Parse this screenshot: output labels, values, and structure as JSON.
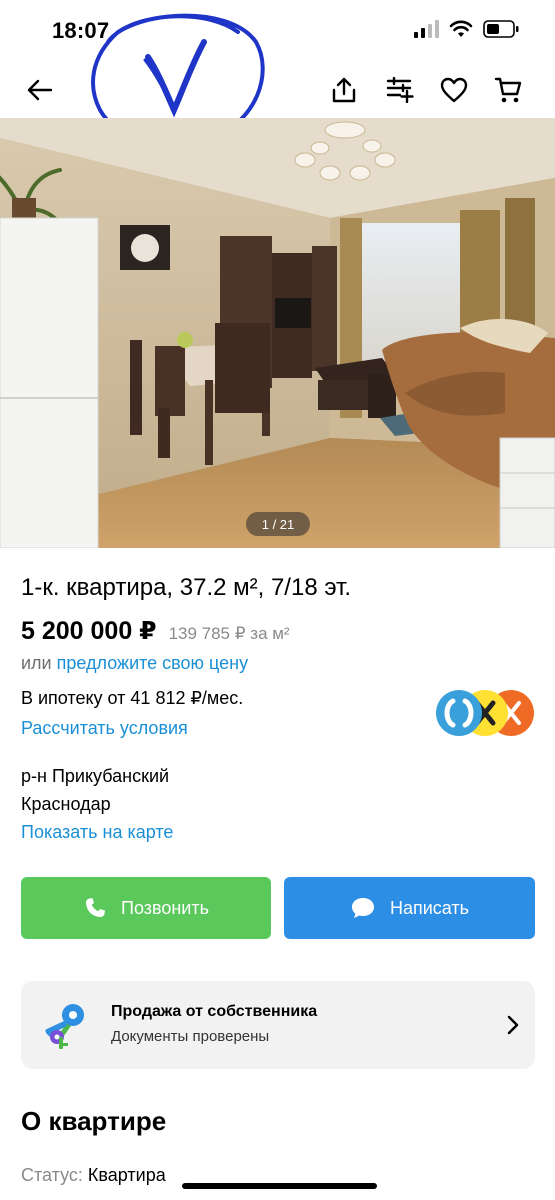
{
  "status_bar": {
    "time": "18:07"
  },
  "annotation": {
    "mark": "V"
  },
  "nav": {
    "back_icon": "arrow-left-icon",
    "share_icon": "share-icon",
    "compare_icon": "compare-add-icon",
    "favorite_icon": "heart-icon",
    "cart_icon": "cart-icon"
  },
  "gallery": {
    "counter": "1 / 21"
  },
  "listing": {
    "title": "1-к. квартира, 37.2 м², 7/18 эт.",
    "price": "5 200 000 ₽",
    "price_per_m2": "139 785 ₽ за м²",
    "offer_prefix": "или",
    "offer_link": "предложите свою цену",
    "mortgage": "В ипотеку от 41 812 ₽/мес.",
    "calc_link": "Рассчитать условия",
    "district": "р-н Прикубанский",
    "city": "Краснодар",
    "map_link": "Показать на карте"
  },
  "actions": {
    "call_label": "Позвонить",
    "write_label": "Написать"
  },
  "owner": {
    "title": "Продажа от собственника",
    "subtitle": "Документы проверены"
  },
  "about": {
    "heading": "О квартире",
    "status_key": "Статус:",
    "status_value": "Квартира"
  },
  "colors": {
    "link": "#1a8fd6",
    "call_button": "#5ac85a",
    "write_button": "#2d8ee6",
    "card_bg": "#f2f2f2",
    "annotation": "#1f35c8"
  }
}
